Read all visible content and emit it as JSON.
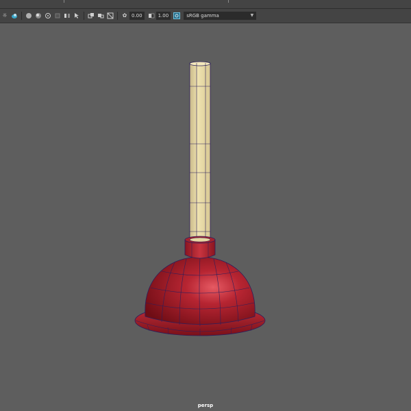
{
  "toolbar": {
    "exposure_value": "0.00",
    "gamma_value": "1.00",
    "color_space": "sRGB gamma",
    "icons": [
      "light-icon",
      "lighting-icon",
      "shaded-sphere-icon",
      "textured-sphere-icon",
      "isolate-icon",
      "xray-icon",
      "select-icon",
      "hud-icon",
      "frame-icon",
      "resolution-gate-icon",
      "grid-toggle-icon",
      "exposure-icon",
      "gamma-icon",
      "color-management-icon"
    ]
  },
  "viewport": {
    "camera": "persp",
    "model": "plunger",
    "colors": {
      "background": "#5e5e5e",
      "handle": "#e7d7a1",
      "cup": "#9b1a24",
      "wireframe": "#2b1f5c"
    }
  }
}
